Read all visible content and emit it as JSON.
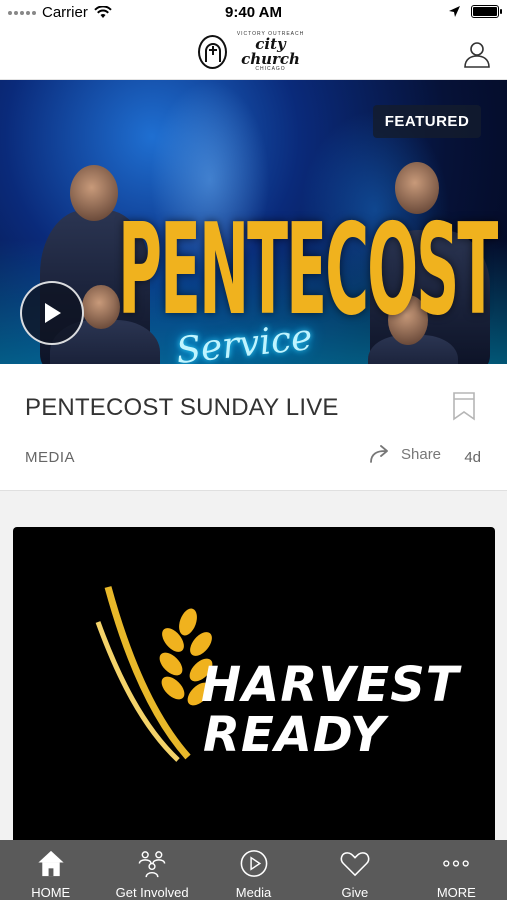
{
  "status_bar": {
    "carrier": "Carrier",
    "time": "9:40 AM"
  },
  "header": {
    "logo": {
      "top_text": "VICTORY OUTREACH",
      "name": "city church",
      "bottom_text": "CHICAGO"
    },
    "profile_icon": "person-outline-icon"
  },
  "featured_card": {
    "image_title": "PENTECOST",
    "image_subtitle": "Service",
    "badge": "FEATURED",
    "title": "PENTECOST SUNDAY LIVE",
    "category": "MEDIA",
    "share_label": "Share",
    "age": "4d"
  },
  "second_card": {
    "line1": "HARVEST",
    "line2": "READY"
  },
  "tab_bar": {
    "items": [
      {
        "label": "HOME",
        "icon": "home-icon"
      },
      {
        "label": "Get Involved",
        "icon": "people-icon"
      },
      {
        "label": "Media",
        "icon": "play-circle-icon"
      },
      {
        "label": "Give",
        "icon": "heart-icon"
      },
      {
        "label": "MORE",
        "icon": "more-dots-icon"
      }
    ]
  },
  "colors": {
    "tab_bar_bg": "#5a5a5a",
    "accent_gold": "#f0b21e",
    "neon_blue": "#33d8ff"
  }
}
